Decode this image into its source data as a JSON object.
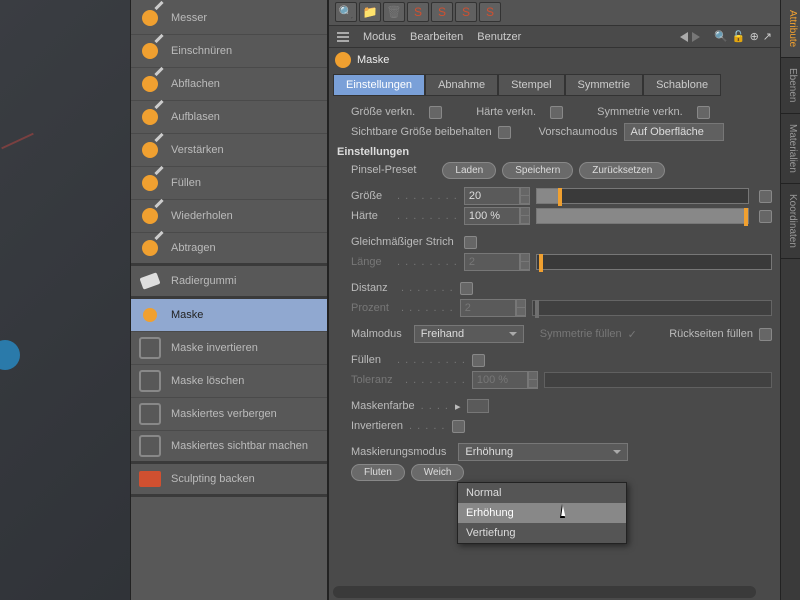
{
  "tools": [
    {
      "label": "Messer"
    },
    {
      "label": "Einschnüren"
    },
    {
      "label": "Abflachen"
    },
    {
      "label": "Aufblasen"
    },
    {
      "label": "Verstärken"
    },
    {
      "label": "Füllen"
    },
    {
      "label": "Wiederholen"
    },
    {
      "label": "Abtragen"
    }
  ],
  "eraser": {
    "label": "Radiergummi"
  },
  "mask_tools": [
    {
      "label": "Maske",
      "selected": true
    },
    {
      "label": "Maske invertieren"
    },
    {
      "label": "Maske löschen"
    },
    {
      "label": "Maskiertes verbergen"
    },
    {
      "label": "Maskiertes sichtbar machen"
    }
  ],
  "bake": {
    "label": "Sculpting backen"
  },
  "nav": {
    "modus": "Modus",
    "bearbeiten": "Bearbeiten",
    "benutzer": "Benutzer"
  },
  "object": {
    "name": "Maske"
  },
  "tabs": [
    "Einstellungen",
    "Abnahme",
    "Stempel",
    "Symmetrie",
    "Schablone"
  ],
  "link_row": {
    "size": "Größe verkn.",
    "hardness": "Härte verkn.",
    "symmetry": "Symmetrie verkn."
  },
  "visible_row": {
    "label": "Sichtbare Größe beibehalten",
    "preview_label": "Vorschaumodus",
    "preview_value": "Auf Oberfläche"
  },
  "section": "Einstellungen",
  "preset": {
    "label": "Pinsel-Preset",
    "load": "Laden",
    "save": "Speichern",
    "reset": "Zurücksetzen"
  },
  "size": {
    "label": "Größe",
    "value": "20"
  },
  "hardness": {
    "label": "Härte",
    "value": "100 %"
  },
  "steady": {
    "label": "Gleichmäßiger Strich"
  },
  "length": {
    "label": "Länge",
    "value": "2"
  },
  "distance": {
    "label": "Distanz"
  },
  "percent": {
    "label": "Prozent",
    "value": "2"
  },
  "paintmode": {
    "label": "Malmodus",
    "value": "Freihand",
    "sym_fill": "Symmetrie füllen",
    "back_fill": "Rückseiten füllen"
  },
  "fill": {
    "label": "Füllen"
  },
  "tolerance": {
    "label": "Toleranz",
    "value": "100 %"
  },
  "maskcolor": {
    "label": "Maskenfarbe"
  },
  "invert": {
    "label": "Invertieren"
  },
  "maskmode": {
    "label": "Maskierungsmodus",
    "value": "Erhöhung",
    "flood": "Fluten",
    "soft": "Weich"
  },
  "dropdown": {
    "items": [
      "Normal",
      "Erhöhung",
      "Vertiefung"
    ],
    "highlighted": 1
  },
  "side_tabs": [
    "Attribute",
    "Ebenen",
    "Materialien",
    "Koordinaten"
  ]
}
